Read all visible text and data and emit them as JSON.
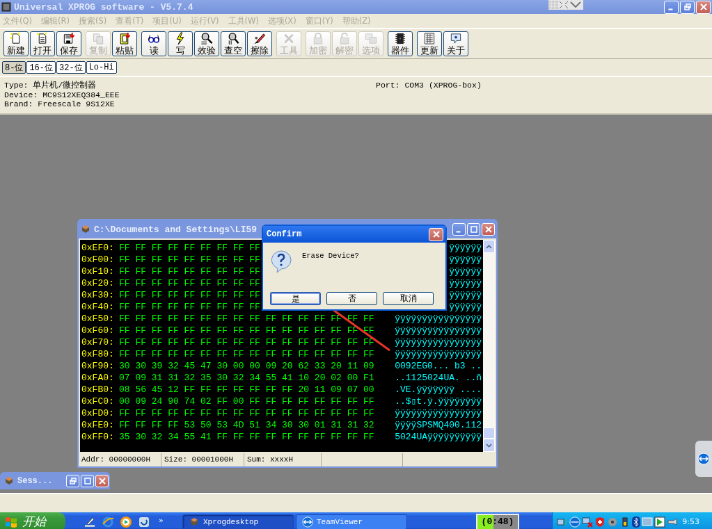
{
  "window": {
    "title": "Universal XPROG software - V5.7.4"
  },
  "menu": [
    {
      "label": "文件(Q)",
      "disabled": true
    },
    {
      "label": "编辑(R)",
      "disabled": true
    },
    {
      "label": "搜索(S)",
      "disabled": true
    },
    {
      "label": "查看(T)",
      "disabled": true
    },
    {
      "label": "项目(U)",
      "disabled": true
    },
    {
      "label": "运行(V)",
      "disabled": true
    },
    {
      "label": "工具(W)",
      "disabled": true
    },
    {
      "label": "选项(X)",
      "disabled": true
    },
    {
      "label": "窗口(Y)",
      "disabled": true
    },
    {
      "label": "帮助(Z)",
      "disabled": true
    }
  ],
  "toolbar": [
    {
      "buttons": [
        {
          "label": "新建",
          "disabled": false
        },
        {
          "label": "打开",
          "disabled": false
        },
        {
          "label": "保存",
          "disabled": false
        }
      ]
    },
    {
      "buttons": [
        {
          "label": "复制",
          "disabled": true
        },
        {
          "label": "粘贴",
          "disabled": false
        }
      ]
    },
    {
      "buttons": [
        {
          "label": "读",
          "disabled": false
        },
        {
          "label": "写",
          "disabled": false
        },
        {
          "label": "效验",
          "disabled": false
        },
        {
          "label": "查空",
          "disabled": false
        },
        {
          "label": "擦除",
          "disabled": false
        }
      ]
    },
    {
      "buttons": [
        {
          "label": "工具",
          "disabled": true
        }
      ]
    },
    {
      "buttons": [
        {
          "label": "加密",
          "disabled": true
        },
        {
          "label": "解密",
          "disabled": true
        },
        {
          "label": "选项",
          "disabled": true
        }
      ]
    },
    {
      "buttons": [
        {
          "label": "器件",
          "disabled": false
        }
      ]
    },
    {
      "buttons": [
        {
          "label": "更新",
          "disabled": false
        },
        {
          "label": "关于",
          "disabled": false
        }
      ]
    }
  ],
  "view_tabs": [
    {
      "label": "8-位",
      "selected": true
    },
    {
      "label": "16-位",
      "selected": false
    },
    {
      "label": "32-位",
      "selected": false
    },
    {
      "label": "Lo-Hi",
      "selected": false
    }
  ],
  "info": {
    "lines": [
      "Type: 单片机/微控制器",
      "Device: MC9S12XEQ384_EEE",
      "Brand: Freescale 9S12XE"
    ],
    "port": "Port: COM3 (XPROG-box)"
  },
  "hex_window": {
    "title": "C:\\Documents and Settings\\LI59",
    "rows": [
      {
        "address": "0xEF0:",
        "hex": "FF FF FF FF FF FF FF FF FF",
        "ascii": "ÿÿÿÿÿÿ"
      },
      {
        "address": "0xF00:",
        "hex": "FF FF FF FF FF FF FF FF FF",
        "ascii": "ÿÿÿÿÿÿ"
      },
      {
        "address": "0xF10:",
        "hex": "FF FF FF FF FF FF FF FF FF",
        "ascii": "ÿÿÿÿÿÿ"
      },
      {
        "address": "0xF20:",
        "hex": "FF FF FF FF FF FF FF FF FF",
        "ascii": "ÿÿÿÿÿÿ"
      },
      {
        "address": "0xF30:",
        "hex": "FF FF FF FF FF FF FF FF FF",
        "ascii": "ÿÿÿÿÿÿ"
      },
      {
        "address": "0xF40:",
        "hex": "FF FF FF FF FF FF FF FF FF",
        "ascii": "ÿÿÿÿÿÿ"
      },
      {
        "address": "0xF50:",
        "hex": "FF FF FF FF FF FF FF FF FF FF FF FF FF FF FF FF",
        "ascii": "ÿÿÿÿÿÿÿÿÿÿÿÿÿÿÿÿ"
      },
      {
        "address": "0xF60:",
        "hex": "FF FF FF FF FF FF FF FF FF FF FF FF FF FF FF FF",
        "ascii": "ÿÿÿÿÿÿÿÿÿÿÿÿÿÿÿÿ"
      },
      {
        "address": "0xF70:",
        "hex": "FF FF FF FF FF FF FF FF FF FF FF FF FF FF FF FF",
        "ascii": "ÿÿÿÿÿÿÿÿÿÿÿÿÿÿÿÿ"
      },
      {
        "address": "0xF80:",
        "hex": "FF FF FF FF FF FF FF FF FF FF FF FF FF FF FF FF",
        "ascii": "ÿÿÿÿÿÿÿÿÿÿÿÿÿÿÿÿ"
      },
      {
        "address": "0xF90:",
        "hex": "30 30 39 32 45 47 30 00 00 09 20 62 33 20 11 09",
        "ascii": "0092EG0... b3 .."
      },
      {
        "address": "0xFA0:",
        "hex": "07 09 31 31 32 35 30 32 34 55 41 10 20 02 00 F1",
        "ascii": "..1125024UA. ..ñ"
      },
      {
        "address": "0xFB0:",
        "hex": "08 56 45 12 FF FF FF FF FF FF FF 20 11 09 07 00",
        "ascii": ".VE.ÿÿÿÿÿÿÿ ...."
      },
      {
        "address": "0xFC0:",
        "hex": "00 09 24 90 74 02 FF 00 FF FF FF FF FF FF FF FF",
        "ascii": "..$▯t.ÿ.ÿÿÿÿÿÿÿÿ"
      },
      {
        "address": "0xFD0:",
        "hex": "FF FF FF FF FF FF FF FF FF FF FF FF FF FF FF FF",
        "ascii": "ÿÿÿÿÿÿÿÿÿÿÿÿÿÿÿÿ"
      },
      {
        "address": "0xFE0:",
        "hex": "FF FF FF FF 53 50 53 4D 51 34 30 30 01 31 31 32",
        "ascii": "ÿÿÿÿSPSMQ400.112"
      },
      {
        "address": "0xFF0:",
        "hex": "35 30 32 34 55 41 FF FF FF FF FF FF FF FF FF FF",
        "ascii": "5024UAÿÿÿÿÿÿÿÿÿÿ"
      }
    ],
    "status": [
      "Addr: 00000000H",
      "Size: 00001000H",
      "Sum: xxxxH"
    ]
  },
  "dialog": {
    "title": "Confirm",
    "message": "Erase Device?",
    "buttons": [
      {
        "label": "是",
        "default": true
      },
      {
        "label": "否",
        "default": false
      },
      {
        "label": "取消",
        "default": false
      }
    ]
  },
  "minimized_window": {
    "title": "Sess..."
  },
  "taskbar": {
    "start": "开始",
    "overflow": "»",
    "tasks": [
      {
        "label": "Xprogdesktop",
        "selected": true
      },
      {
        "label": "TeamViewer",
        "selected": false
      }
    ],
    "timer": {
      "text": "(0:48)",
      "level": 0.4
    },
    "clock": "9:53"
  }
}
